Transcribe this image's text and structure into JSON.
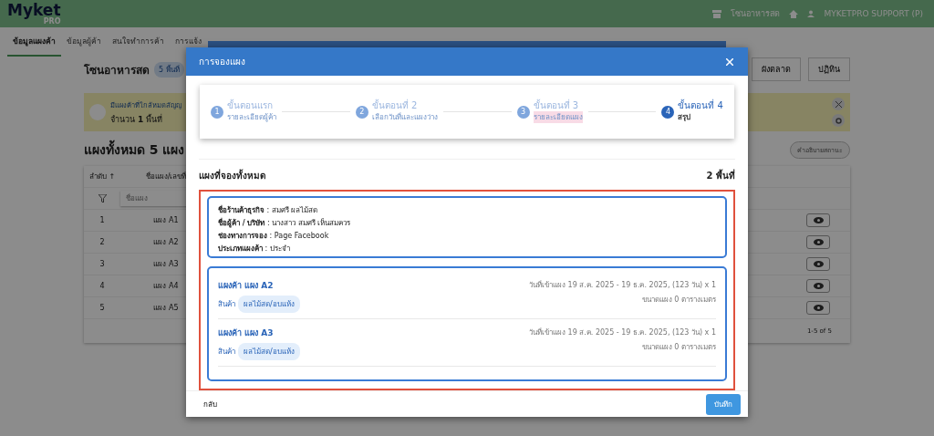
{
  "header": {
    "logo": "Myket",
    "logo_sub": "PRO",
    "market": "โซนอาหารสด",
    "user": "MYKETPRO SUPPORT (P)"
  },
  "nav_tabs": [
    {
      "label": "ข้อมูลแผงค้า",
      "selected": true
    },
    {
      "label": "ข้อมูลผู้ค้า",
      "selected": false
    },
    {
      "label": "สนใจทำการค้า",
      "selected": false
    },
    {
      "label": "การแจ้ง",
      "selected": false
    }
  ],
  "page": {
    "title": "โซนอาหารสด",
    "badge": "5 พื้นที่",
    "view_buttons": [
      {
        "label": "ผังตลาด",
        "selected": false
      },
      {
        "label": "ปฏิทิน",
        "selected": false
      }
    ]
  },
  "alert": {
    "title": "มีแผงค้าที่ใกล้หมดสัญญ",
    "count": "จำนวน **1** พื้นที่"
  },
  "section": {
    "title": "แผงทั้งหมด 5 แผง",
    "legend_button": "คำอธิบายสถานะ"
  },
  "table": {
    "columns": [
      "ลำดับ ↑",
      "ชื่อแผง/เลขที่"
    ],
    "filter_placeholder": "ชื่อแผง",
    "rows": [
      {
        "no": "1",
        "name": "แผง A1"
      },
      {
        "no": "2",
        "name": "แผง A2"
      },
      {
        "no": "3",
        "name": "แผง A3"
      },
      {
        "no": "4",
        "name": "แผง A4"
      },
      {
        "no": "5",
        "name": "แผง A5"
      }
    ],
    "pagination": "1-5 of 5"
  },
  "modal": {
    "title": "การจองแผง",
    "steps": [
      {
        "number": "1",
        "title": "ขั้นตอนแรก",
        "subtitle": "รายละเอียดผู้ค้า",
        "selected": false,
        "subtitle_highlighted": false
      },
      {
        "number": "2",
        "title": "ขั้นตอนที่ 2",
        "subtitle": "เลือกวันที่และแผงว่าง",
        "selected": false,
        "subtitle_highlighted": false
      },
      {
        "number": "3",
        "title": "ขั้นตอนที่ 3",
        "subtitle": "รายละเอียดแผง",
        "selected": false,
        "subtitle_highlighted": true
      },
      {
        "number": "4",
        "title": "ขั้นตอนที่ 4",
        "subtitle": "สรุป",
        "selected": true,
        "subtitle_highlighted": false
      }
    ],
    "summary_title": "แผงที่จองทั้งหมด",
    "summary_count": "2 พื้นที่",
    "info": [
      "**ชื่อร้านค้าธุรกิจ** : สมศรี ผลไม้สด",
      "**ชื่อผู้ค้า / บริษัท** : นางสาว สมศรี เห็นสมควร",
      "**ช่องทางการจอง** : Page Facebook",
      "**ประเภทแผงค้า** : ประจำ"
    ],
    "stalls": [
      {
        "name": "แผงค้า แผง A2",
        "product_label": "สินค้า",
        "product_tag": "ผลไม้สด/อบแห้ง",
        "dates": "วันที่เข้าแผง 19 ส.ค. 2025 - 19 ธ.ค. 2025, (123 วัน) x 1",
        "size": "ขนาดแผง 0 ตารางเมตร"
      },
      {
        "name": "แผงค้า แผง A3",
        "product_label": "สินค้า",
        "product_tag": "ผลไม้สด/อบแห้ง",
        "dates": "วันที่เข้าแผง 19 ส.ค. 2025 - 19 ธ.ค. 2025, (123 วัน) x 1",
        "size": "ขนาดแผง 0 ตารางเมตร"
      }
    ],
    "back_button": "กลับ",
    "save_button": "บันทึก"
  }
}
